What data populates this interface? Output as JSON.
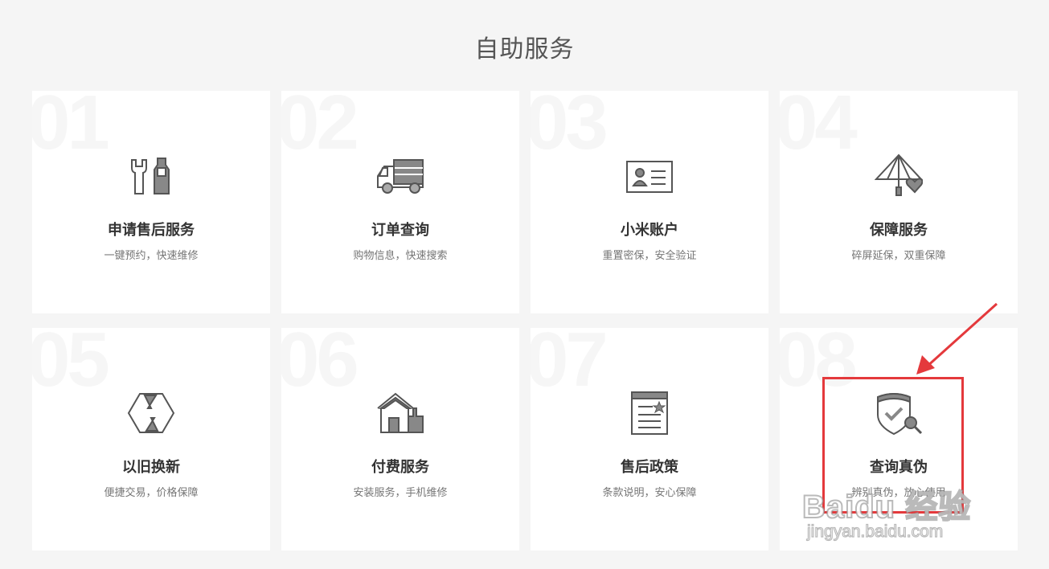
{
  "page_title": "自助服务",
  "cards": [
    {
      "num": "01",
      "icon": "wrench-icon",
      "name": "申请售后服务",
      "desc": "一键预约，快速维修"
    },
    {
      "num": "02",
      "icon": "truck-icon",
      "name": "订单查询",
      "desc": "购物信息，快速搜索"
    },
    {
      "num": "03",
      "icon": "id-card-icon",
      "name": "小米账户",
      "desc": "重置密保，安全验证"
    },
    {
      "num": "04",
      "icon": "umbrella-heart-icon",
      "name": "保障服务",
      "desc": "碎屏延保，双重保障"
    },
    {
      "num": "05",
      "icon": "exchange-icon",
      "name": "以旧换新",
      "desc": "便捷交易，价格保障"
    },
    {
      "num": "06",
      "icon": "house-icon",
      "name": "付费服务",
      "desc": "安装服务，手机维修"
    },
    {
      "num": "07",
      "icon": "policy-doc-icon",
      "name": "售后政策",
      "desc": "条款说明，安心保障"
    },
    {
      "num": "08",
      "icon": "shield-search-icon",
      "name": "查询真伪",
      "desc": "辨别真伪，放心使用"
    }
  ],
  "annotation": {
    "color": "#e4393c"
  },
  "watermark": {
    "logo": "Baidu 经验",
    "url": "jingyan.baidu.com"
  }
}
